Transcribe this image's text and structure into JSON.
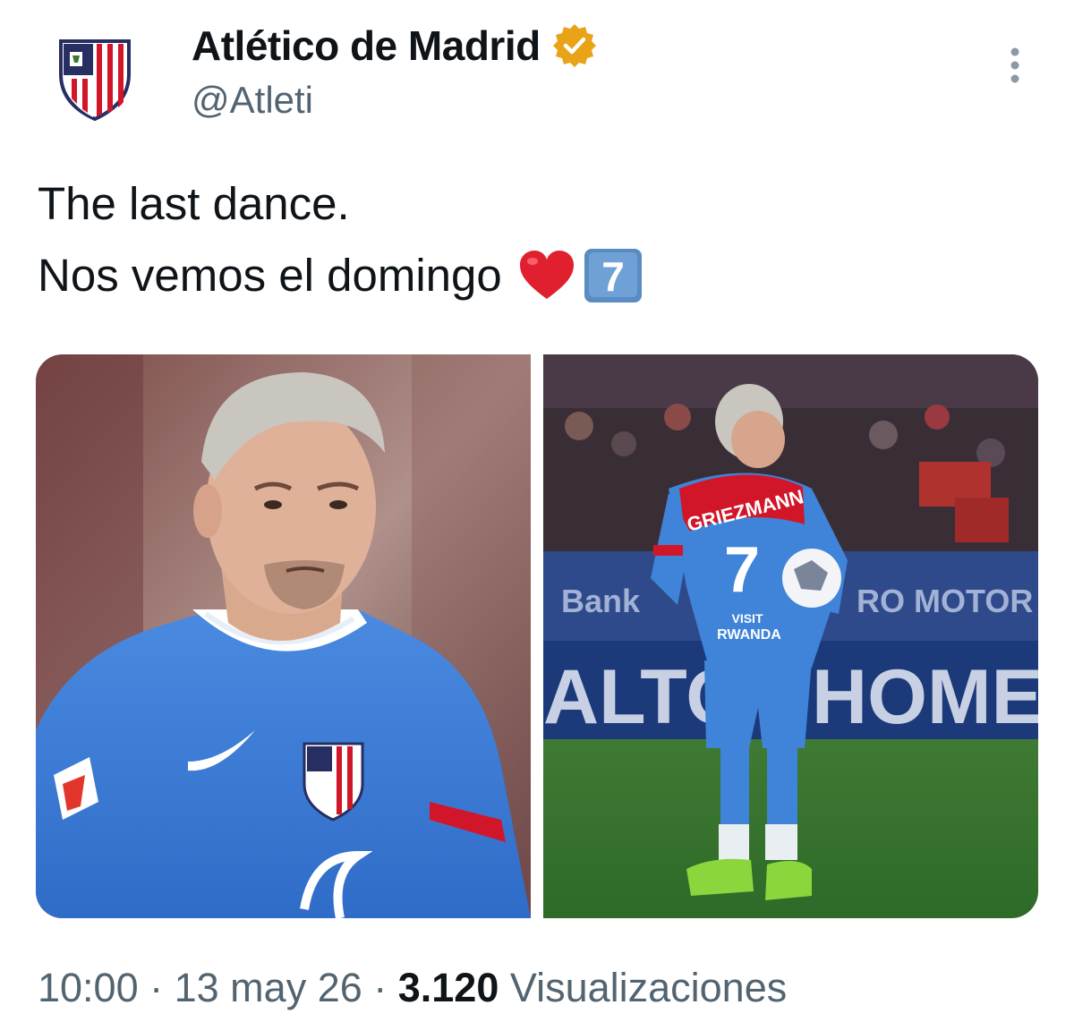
{
  "author": {
    "display_name": "Atlético de Madrid",
    "handle": "@Atleti",
    "avatar_icon": "atletico-crest-icon",
    "verified_icon": "verified-badge-icon",
    "verified_color": "#e8a317"
  },
  "menu": {
    "icon": "more-vertical-icon"
  },
  "tweet": {
    "line1": "The last dance.",
    "line2": "Nos vemos el domingo",
    "emoji1": "red-heart-icon",
    "emoji2": "keycap-7-icon"
  },
  "media": {
    "photo1": {
      "name": "photo-portrait"
    },
    "photo2": {
      "name": "photo-back-view",
      "jersey_name": "GRIEZMANN",
      "jersey_number": "7",
      "sponsor_small": "VISIT",
      "sponsor": "RWANDA",
      "board_left": "Bank",
      "board_right": "RO MOTOR",
      "board_big_left": "ALTO",
      "board_big_right": "HOME"
    }
  },
  "footer": {
    "time": "10:00",
    "sep1": " · ",
    "date": "13 may 26",
    "sep2": " · ",
    "views_count": "3.120",
    "views_label": " Visualizaciones"
  },
  "colors": {
    "text": "#0f1419",
    "secondary": "#536471",
    "kit_blue": "#3b7fd6",
    "crest_red": "#d2162a",
    "crest_navy": "#272e61"
  }
}
